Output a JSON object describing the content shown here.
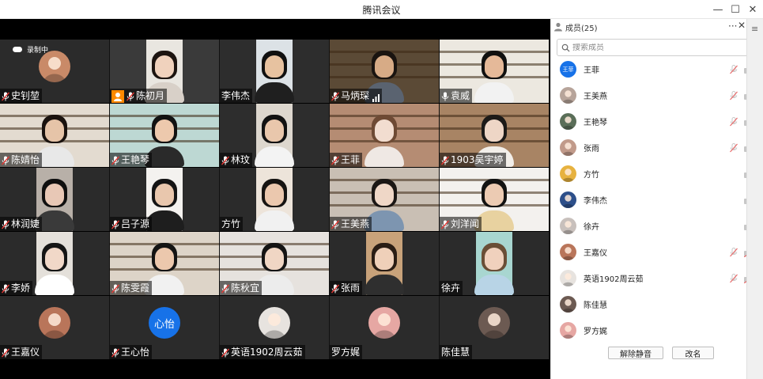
{
  "window": {
    "title": "腾讯会议",
    "controls": {
      "minimize": "—",
      "maximize": "☐",
      "close": "✕"
    }
  },
  "recording": {
    "label": "录制中"
  },
  "tiles": [
    {
      "name": "史钊堃",
      "muted": true,
      "kind": "avatar",
      "avatar_color": "#c98a68"
    },
    {
      "name": "陈初月",
      "muted": true,
      "kind": "video",
      "host": true,
      "bg": "#3a3a3a",
      "frame": "#e9e6e0",
      "skin": "#f0d2bd",
      "hair": "#1c1410",
      "shirt": "#d8d0c8"
    },
    {
      "name": "李伟杰",
      "muted": false,
      "kind": "video",
      "bg": "#2d2d2d",
      "frame": "#dce2e6",
      "skin": "#e7c2a0",
      "hair": "#101010",
      "shirt": "#1f1f1f"
    },
    {
      "name": "马炳琛",
      "muted": true,
      "kind": "video",
      "signal": true,
      "bg": "#4a3a2c",
      "frame": "#5b4a36",
      "skin": "#d7ab86",
      "hair": "#1a1410",
      "shirt": "#5a6370"
    },
    {
      "name": "袁威",
      "muted": false,
      "kind": "video",
      "bg": "#e8e6e0",
      "frame": "#ece8e0",
      "skin": "#e5b999",
      "hair": "#101010",
      "shirt": "#f2f2f2"
    },
    {
      "name": "陈婧怡",
      "muted": true,
      "kind": "video",
      "bg": "#ddd6cc",
      "frame": "#e3dbd0",
      "skin": "#e6c4a8",
      "hair": "#1a120e",
      "shirt": "#e8e8e8"
    },
    {
      "name": "王艳琴",
      "muted": true,
      "kind": "video",
      "bg": "#6a4b32",
      "frame": "#bdd8d3",
      "skin": "#edc9ad",
      "hair": "#121212",
      "shirt": "#2a2a2a"
    },
    {
      "name": "林玟",
      "muted": true,
      "kind": "video",
      "bg": "#2d2d2d",
      "frame": "#ddd7ce",
      "skin": "#e9c7ac",
      "hair": "#121212",
      "shirt": "#f3f3f3"
    },
    {
      "name": "王菲",
      "muted": true,
      "kind": "video",
      "bg": "#3a2f28",
      "frame": "#b58c73",
      "skin": "#f2ddd0",
      "hair": "#6e4a34",
      "shirt": "#efe8e4"
    },
    {
      "name": "1903吴宇婷",
      "muted": true,
      "kind": "video",
      "bg": "#8a6b50",
      "frame": "#a88464",
      "skin": "#eed6c6",
      "hair": "#1c1a18",
      "shirt": "#f2eee9"
    },
    {
      "name": "林润婕",
      "muted": true,
      "kind": "video",
      "bg": "#2b2b2b",
      "frame": "#b8b0a8",
      "skin": "#e8c8b6",
      "hair": "#0f0f0f",
      "shirt": "#3a3a3a"
    },
    {
      "name": "吕子源",
      "muted": true,
      "kind": "video",
      "bg": "#2b2b2b",
      "frame": "#f4f2ef",
      "skin": "#e9c7ad",
      "hair": "#141414",
      "shirt": "#1e1e1e"
    },
    {
      "name": "方竹",
      "muted": false,
      "kind": "video",
      "bg": "#2b2b2b",
      "frame": "#ede4da",
      "skin": "#ebc8ae",
      "hair": "#161412",
      "shirt": "#f1f1f1"
    },
    {
      "name": "王美燕",
      "muted": true,
      "kind": "video",
      "bg": "#cfc6bd",
      "frame": "#c9bfb4",
      "skin": "#efd7c7",
      "hair": "#1b1715",
      "shirt": "#7d95b0"
    },
    {
      "name": "刘洋闻",
      "muted": true,
      "kind": "video",
      "bg": "#f1eee9",
      "frame": "#f3f1ee",
      "skin": "#eccbb3",
      "hair": "#121212",
      "shirt": "#e8d2a0"
    },
    {
      "name": "李娇",
      "muted": true,
      "kind": "video",
      "bg": "#2b2b2b",
      "frame": "#e4e0da",
      "skin": "#f1d8c8",
      "hair": "#151515",
      "shirt": "#ffffff"
    },
    {
      "name": "陈雯霞",
      "muted": true,
      "kind": "video",
      "bg": "#d9d2c7",
      "frame": "#ddd4c8",
      "skin": "#ecc8ad",
      "hair": "#141414",
      "shirt": "#f1f1f1"
    },
    {
      "name": "陈秋宜",
      "muted": true,
      "kind": "video",
      "bg": "#e1dfdc",
      "frame": "#e6e2de",
      "skin": "#f0d6c4",
      "hair": "#141414",
      "shirt": "#ececec"
    },
    {
      "name": "张雨",
      "muted": true,
      "kind": "video",
      "bg": "#2b2b2b",
      "frame": "#c8a27a",
      "skin": "#efd0b9",
      "hair": "#2a1d14",
      "shirt": "#2f2f2f"
    },
    {
      "name": "徐卉",
      "muted": false,
      "kind": "video",
      "bg": "#2b2b2b",
      "frame": "#a8d6d0",
      "skin": "#f0d1bd",
      "hair": "#6a4e36",
      "shirt": "#b8d4e6"
    },
    {
      "name": "王嘉仪",
      "muted": true,
      "kind": "avatar",
      "avatar_color": "#b9755a"
    },
    {
      "name": "王心怡",
      "muted": true,
      "kind": "text-avatar",
      "avatar_text": "心怡"
    },
    {
      "name": "英语1902周云茹",
      "muted": true,
      "kind": "avatar",
      "avatar_color": "#e7e3df"
    },
    {
      "name": "罗方娓",
      "muted": false,
      "kind": "avatar",
      "avatar_color": "#e6a7a3"
    },
    {
      "name": "陈佳慧",
      "muted": false,
      "kind": "avatar",
      "avatar_color": "#6c5a52"
    }
  ],
  "panel": {
    "title": "成员(25)",
    "more": "···",
    "close": "✕",
    "search_placeholder": "搜索成员",
    "members": [
      {
        "name": "王菲",
        "mic_off": true,
        "avatar_text": "王菲",
        "avatar_color": "#1772e8"
      },
      {
        "name": "王美燕",
        "mic_off": true,
        "avatar_color": "#b7a49a"
      },
      {
        "name": "王艳琴",
        "mic_off": true,
        "avatar_color": "#5a6e58"
      },
      {
        "name": "张雨",
        "mic_off": true,
        "avatar_color": "#c19a8a"
      },
      {
        "name": "方竹",
        "mic_off": false,
        "avatar_color": "#e7b23f"
      },
      {
        "name": "李伟杰",
        "mic_off": false,
        "avatar_color": "#2d4f8a"
      },
      {
        "name": "徐卉",
        "mic_off": false,
        "avatar_color": "#c8c0bc"
      },
      {
        "name": "王嘉仪",
        "mic_off": true,
        "avatar_color": "#b9755a",
        "cam_off": true
      },
      {
        "name": "英语1902周云茹",
        "mic_off": true,
        "avatar_color": "#e7e3df",
        "cam_off": true
      },
      {
        "name": "陈佳慧",
        "mic_off": false,
        "avatar_color": "#6c5a52",
        "no_icons": true
      },
      {
        "name": "罗方娓",
        "mic_off": false,
        "avatar_color": "#e6a7a3",
        "no_icons": true
      }
    ],
    "buttons": {
      "unmute_all": "解除静音",
      "rename": "改名"
    }
  },
  "side": {
    "menu": "≡"
  }
}
